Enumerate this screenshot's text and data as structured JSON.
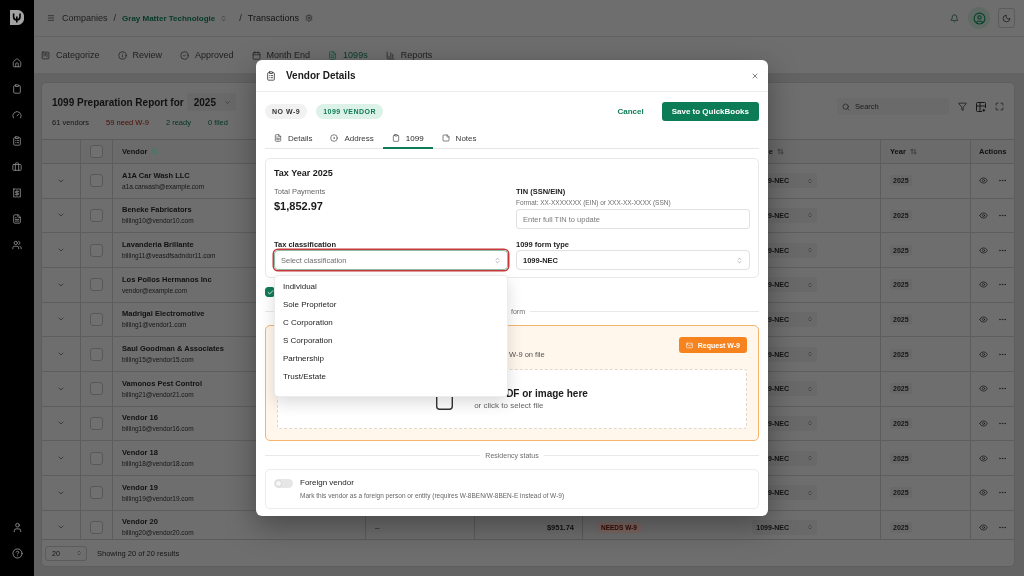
{
  "header": {
    "breadcrumbs": [
      {
        "label": "Companies",
        "kind": "link"
      },
      {
        "separator": "/",
        "label": "Gray Matter Technologie",
        "kind": "switcher"
      },
      {
        "separator": "/",
        "label": "Transactions",
        "kind": "current"
      }
    ]
  },
  "nav_tabs": [
    {
      "label": "Categorize",
      "selected": false
    },
    {
      "label": "Review",
      "selected": false
    },
    {
      "label": "Approved",
      "selected": false
    },
    {
      "label": "Month End",
      "selected": false
    },
    {
      "label": "1099s",
      "selected": true
    },
    {
      "label": "Reports",
      "selected": false
    }
  ],
  "report": {
    "title": "1099 Preparation Report for",
    "year": "2025",
    "stats": [
      {
        "text": "61 vendors",
        "kind": "neutral"
      },
      {
        "text": "59 need W-9",
        "kind": "warning"
      },
      {
        "text": "2 ready",
        "kind": "success"
      },
      {
        "text": "0 filed",
        "kind": "success"
      }
    ],
    "search": {
      "placeholder": "Search"
    }
  },
  "table": {
    "select_all": {
      "checked": false
    },
    "columns": [
      {
        "label": "Vendor",
        "sortable": true,
        "sorted": true
      },
      {
        "label": "e",
        "sortable": true,
        "sorted": false
      },
      {
        "label": "Year",
        "sortable": true,
        "sorted": false
      },
      {
        "label": "Actions",
        "sortable": false,
        "sorted": false
      }
    ],
    "rows": [
      {
        "vendor": "A1A Car Wash LLC",
        "email": "a1a.carwash@example.com",
        "checked": false,
        "form_type": "9-NEC",
        "year": "2025"
      },
      {
        "vendor": "Beneke Fabricators",
        "email": "billing10@vendor10.com",
        "checked": false,
        "form_type": "9-NEC",
        "year": "2025"
      },
      {
        "vendor": "Lavanderia Brillante",
        "email": "billing11@veasdfsadndor11.com",
        "checked": false,
        "form_type": "9-NEC",
        "year": "2025"
      },
      {
        "vendor": "Los Pollos Hermanos Inc",
        "email": "vendor@example.com",
        "checked": false,
        "form_type": "9-NEC",
        "year": "2025"
      },
      {
        "vendor": "Madrigal Electromotive",
        "email": "billing1@vendor1.com",
        "checked": false,
        "form_type": "9-NEC",
        "year": "2025"
      },
      {
        "vendor": "Saul Goodman & Associates",
        "email": "billing15@vendor15.com",
        "checked": false,
        "form_type": "9-NEC",
        "year": "2025"
      },
      {
        "vendor": "Vamonos Pest Control",
        "email": "billing21@vendor21.com",
        "checked": false,
        "form_type": "9-NEC",
        "year": "2025"
      },
      {
        "vendor": "Vendor 16",
        "email": "billing16@vendor16.com",
        "checked": false,
        "form_type": "9-NEC",
        "year": "2025"
      },
      {
        "vendor": "Vendor 18",
        "email": "billing18@vendor18.com",
        "checked": false,
        "form_type": "9-NEC",
        "year": "2025"
      },
      {
        "vendor": "Vendor 19",
        "email": "billing19@vendor19.com",
        "checked": false,
        "form_type": "9-NEC",
        "year": "2025"
      },
      {
        "vendor": "Vendor 20",
        "email": "billing20@vendor20.com",
        "checked": false,
        "column_4": "–",
        "amount": "$951.74",
        "status": "NEEDS W-9",
        "form_type": "1099-NEC",
        "year": "2025"
      }
    ],
    "footer": {
      "page_size": "20",
      "summary": "Showing 20 of 20 results"
    }
  },
  "vendor_details": {
    "title": "Vendor Details",
    "badges": [
      {
        "text": "NO W-9",
        "kind": "neutral"
      },
      {
        "text": "1099 VENDOR",
        "kind": "success"
      }
    ],
    "cancel": "Cancel",
    "save": "Save to QuickBooks",
    "tabs": [
      {
        "label": "Details",
        "selected": false
      },
      {
        "label": "Address",
        "selected": false
      },
      {
        "label": "1099",
        "selected": true
      },
      {
        "label": "Notes",
        "selected": false
      }
    ],
    "tax_year": {
      "title": "Tax Year 2025",
      "total_label": "Total Payments",
      "total": "$1,852.97",
      "tin": {
        "label": "TIN (SSN/EIN)",
        "hint": "Format: XX-XXXXXXX (EIN) or XXX-XX-XXXX (SSN)",
        "placeholder": "Enter full TIN to update"
      },
      "classification": {
        "label": "Tax classification",
        "placeholder": "Select classification",
        "error": true,
        "expanded": true,
        "options": [
          {
            "label": "Individual",
            "selected": false
          },
          {
            "label": "Sole Proprietor",
            "selected": false
          },
          {
            "label": "C Corporation",
            "selected": false
          },
          {
            "label": "S Corporation",
            "selected": false
          },
          {
            "label": "Partnership",
            "selected": false
          },
          {
            "label": "Trust/Estate",
            "selected": false
          }
        ]
      },
      "form_type": {
        "label": "1099 form type",
        "value": "1099-NEC"
      }
    },
    "checkbox": {
      "checked": true
    },
    "w9": {
      "divider": "form",
      "status": "W-9 on file",
      "request": "Request W-9",
      "drop_title": "DF or image here",
      "drop_hint": "or click to select file"
    },
    "residency": {
      "divider": "Residency status",
      "foreign": {
        "on": false,
        "label": "Foreign vendor",
        "description": "Mark this vendor as a foreign person or entity (requires W-8BEN/W-8BEN-E instead of W-9)"
      }
    }
  }
}
